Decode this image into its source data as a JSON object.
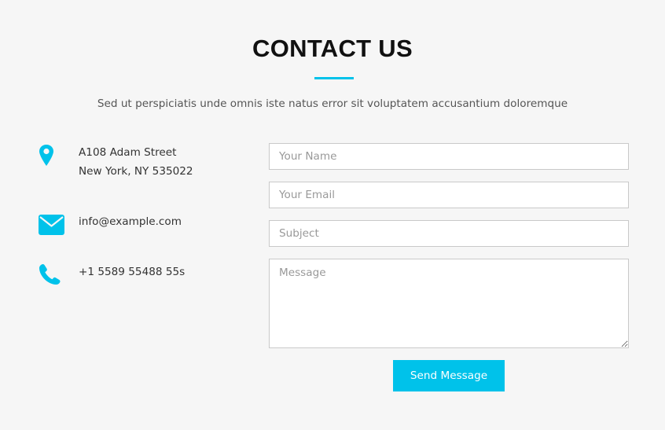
{
  "header": {
    "title": "CONTACT US",
    "subtitle": "Sed ut perspiciatis unde omnis iste natus error sit voluptatem accusantium doloremque"
  },
  "contact_info": {
    "address": {
      "icon": "map-pin-icon",
      "line1": "A108 Adam Street",
      "line2": "New York, NY 535022"
    },
    "email": {
      "icon": "envelope-icon",
      "text": "info@example.com"
    },
    "phone": {
      "icon": "phone-icon",
      "text": "+1 5589 55488 55s"
    }
  },
  "form": {
    "name_placeholder": "Your Name",
    "email_placeholder": "Your Email",
    "subject_placeholder": "Subject",
    "message_placeholder": "Message",
    "submit_label": "Send Message"
  },
  "colors": {
    "accent": "#00c2ea",
    "background": "#f6f6f6",
    "title": "#111111"
  }
}
